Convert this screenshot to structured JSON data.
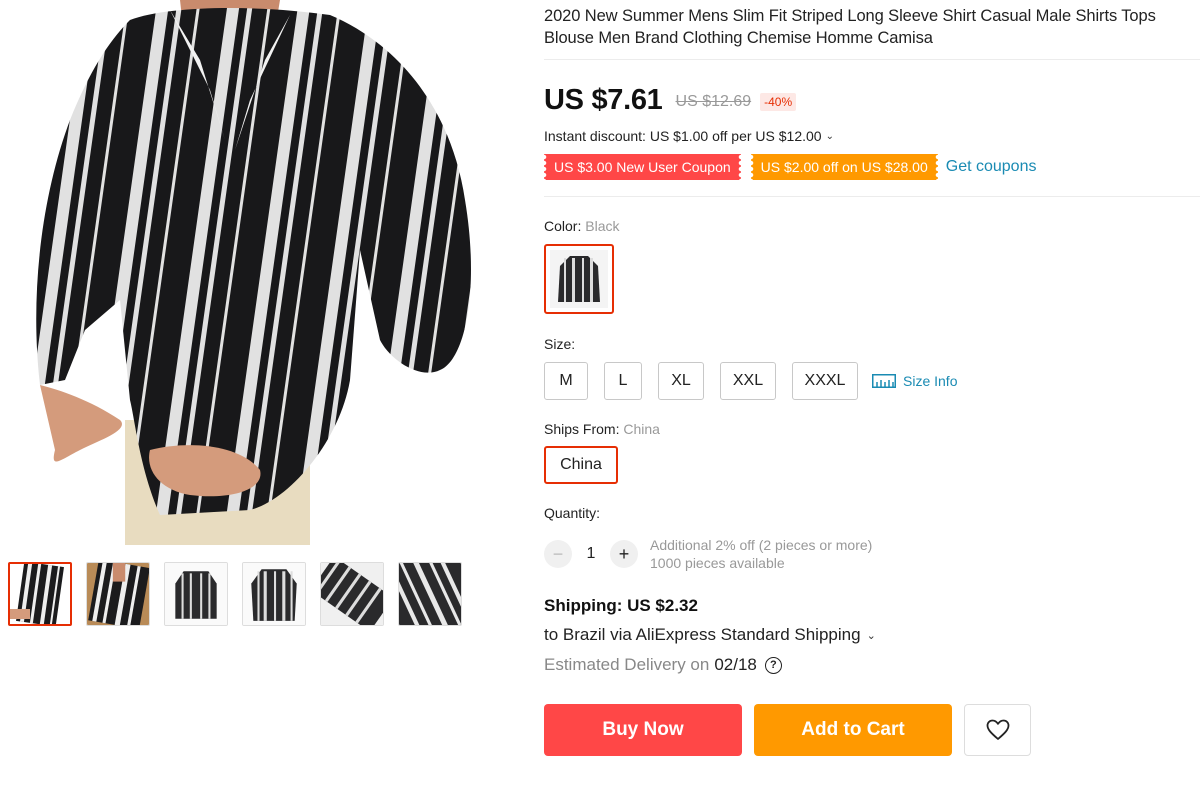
{
  "product": {
    "title": "2020 New Summer Mens Slim Fit Striped Long Sleeve Shirt Casual Male Shirts Tops Blouse Men Brand Clothing Chemise Homme Camisa",
    "main_image_icon": "striped-shirt-photo",
    "thumbnails": [
      {
        "name": "thumb-1",
        "active": true
      },
      {
        "name": "thumb-2",
        "active": false
      },
      {
        "name": "thumb-3",
        "active": false
      },
      {
        "name": "thumb-4",
        "active": false
      },
      {
        "name": "thumb-5",
        "active": false
      },
      {
        "name": "thumb-6",
        "active": false
      }
    ]
  },
  "price": {
    "current": "US $7.61",
    "original": "US $12.69",
    "discount": "-40%"
  },
  "instant_discount": "Instant discount: US $1.00 off per US $12.00",
  "coupons": {
    "new_user": "US $3.00 New User Coupon",
    "store": "US $2.00 off on US $28.00",
    "get_link": "Get coupons"
  },
  "color": {
    "label": "Color:",
    "selected": "Black"
  },
  "size": {
    "label": "Size:",
    "options": [
      "M",
      "L",
      "XL",
      "XXL",
      "XXXL"
    ],
    "info_link": "Size Info"
  },
  "ships_from": {
    "label": "Ships From:",
    "selected": "China",
    "option": "China"
  },
  "quantity": {
    "label": "Quantity:",
    "value": "1",
    "minus": "−",
    "plus": "+",
    "note_discount": "Additional 2% off (2 pieces or more)",
    "note_available": "1000 pieces available"
  },
  "shipping": {
    "price": "Shipping: US $2.32",
    "destination": "to Brazil via AliExpress Standard Shipping",
    "estimated_label": "Estimated Delivery on",
    "date": "02/18",
    "help": "?"
  },
  "actions": {
    "buy_now": "Buy Now",
    "add_to_cart": "Add to Cart",
    "wishlist_icon": "heart-icon"
  },
  "colors": {
    "accent_red": "#ff4747",
    "accent_orange": "#ff9900",
    "link_blue": "#1a8bb3",
    "selected_border": "#e62e04"
  }
}
